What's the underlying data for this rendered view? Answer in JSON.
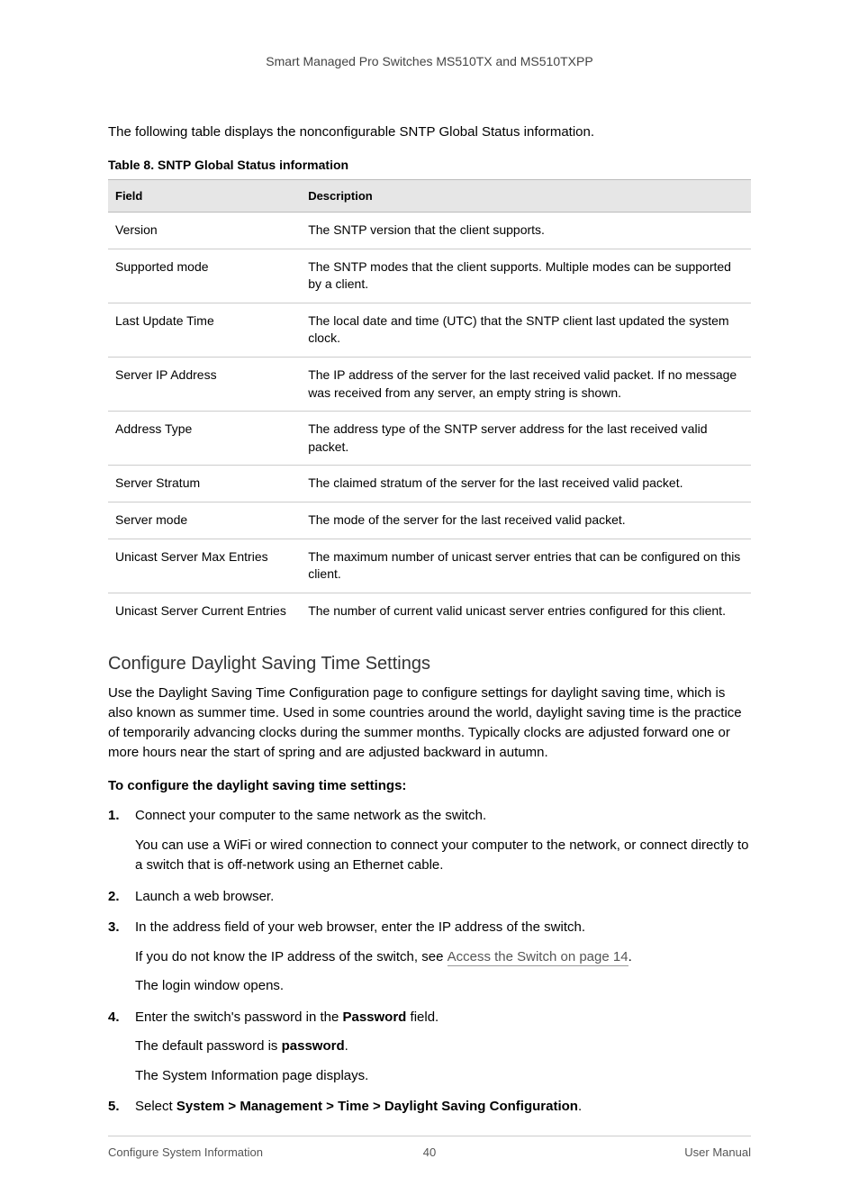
{
  "header": "Smart Managed Pro Switches MS510TX and MS510TXPP",
  "intro": "The following table displays the nonconfigurable SNTP Global Status information.",
  "tableCaption": "Table 8.  SNTP Global Status information",
  "tableHeaders": {
    "col1": "Field",
    "col2": "Description"
  },
  "rows": [
    {
      "field": "Version",
      "desc": "The SNTP version that the client supports."
    },
    {
      "field": "Supported mode",
      "desc": "The SNTP modes that the client supports. Multiple modes can be supported by a client."
    },
    {
      "field": "Last Update Time",
      "desc": "The local date and time (UTC) that the SNTP client last updated the system clock."
    },
    {
      "field": "Server IP Address",
      "desc": "The IP address of the server for the last received valid packet. If no message was received from any server, an empty string is shown."
    },
    {
      "field": "Address Type",
      "desc": "The address type of the SNTP server address for the last received valid packet."
    },
    {
      "field": "Server Stratum",
      "desc": "The claimed stratum of the server for the last received valid packet."
    },
    {
      "field": "Server mode",
      "desc": "The mode of the server for the last received valid packet."
    },
    {
      "field": "Unicast Server Max Entries",
      "desc": "The maximum number of unicast server entries that can be configured on this client."
    },
    {
      "field": "Unicast Server Current Entries",
      "desc": "The number of current valid unicast server entries configured for this client."
    }
  ],
  "sectionHeading": "Configure Daylight Saving Time Settings",
  "sectionPara": "Use the Daylight Saving Time Configuration page to configure settings for daylight saving time, which is also known as summer time. Used in some countries around the world, daylight saving time is the practice of temporarily advancing clocks during the summer months. Typically clocks are adjusted forward one or more hours near the start of spring and are adjusted backward in autumn.",
  "procHeading": "To configure the daylight saving time settings:",
  "steps": {
    "s1": "Connect your computer to the same network as the switch.",
    "s1sub": "You can use a WiFi or wired connection to connect your computer to the network, or connect directly to a switch that is off-network using an Ethernet cable.",
    "s2": "Launch a web browser.",
    "s3": "In the address field of your web browser, enter the IP address of the switch.",
    "s3sub_pre": "If you do not know the IP address of the switch, see ",
    "s3sub_link": "Access the Switch on page 14",
    "s3sub_post": ".",
    "s3sub2": "The login window opens.",
    "s4_pre": "Enter the switch's password in the ",
    "s4_bold": "Password",
    "s4_post": " field.",
    "s4sub_pre": "The default password is ",
    "s4sub_bold": "password",
    "s4sub_post": ".",
    "s4sub2": "The System Information page displays.",
    "s5_pre": "Select ",
    "s5_bold": "System > Management > Time > Daylight Saving Configuration",
    "s5_post": "."
  },
  "footer": {
    "left": "Configure System Information",
    "center": "40",
    "right": "User Manual"
  }
}
